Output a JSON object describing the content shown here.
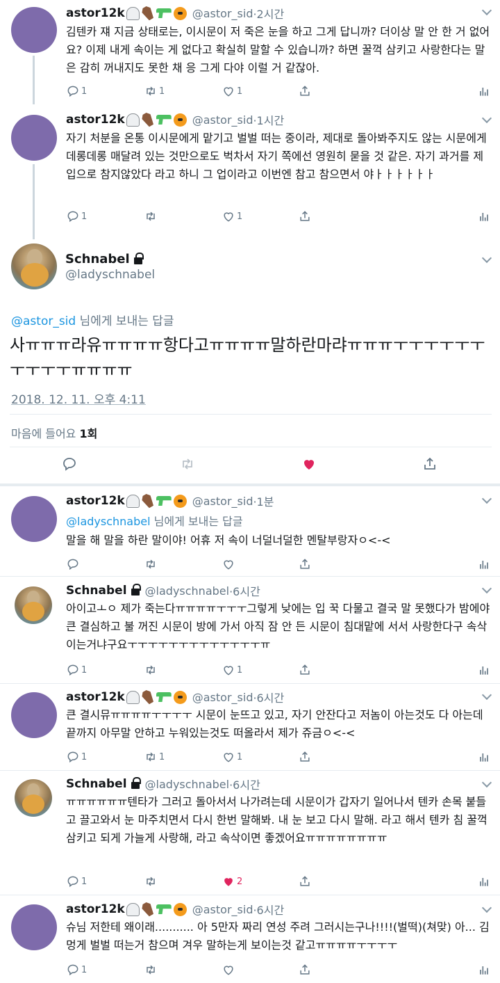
{
  "tweets_before": [
    {
      "name": "astor12k",
      "handle": "@astor_sid",
      "time": "·2시간",
      "text": "김텐카 쟤 지금 상태로는, 이시문이 저 죽은 눈을 하고 그게 답니까? 더이상 말 안 한 거 없어요? 이제 내게 속이는 게 없다고 확실히 말할 수 있습니까? 하면 꿀꺽 삼키고 사랑한다는 말은 감히 꺼내지도 못한 채 응 그게 다야 이럴 거 같잖아.",
      "replies": "1",
      "retweets": "1",
      "likes": "1"
    },
    {
      "name": "astor12k",
      "handle": "@astor_sid",
      "time": "·1시간",
      "text": "자기 처분을 온통 이시문에게 맡기고 벌벌 떠는 중이라, 제대로 돌아봐주지도 않는 시문에게 데롱데롱 매달려 있는 것만으로도 벅차서 자기 쪽에선 영원히 묻을 것 같은. 자기 과거를 제 입으로 참지않았다 라고 하니 그 업이라고 이번엔 참고 참으면서 야ㅏㅏㅏㅏㅏㅏ",
      "replies": "1",
      "retweets": "",
      "likes": "1"
    }
  ],
  "main_tweet": {
    "name": "Schnabel",
    "handle": "@ladyschnabel",
    "reply_to_handle": "@astor_sid",
    "reply_to_suffix": " 님에게 보내는 답글",
    "text": "사ㅠㅠㅠ라유ㅠㅠㅠㅠ항다고ㅠㅠㅠㅠ말하란마랴ㅠㅠㅠㅜㅜㅜㅜㅜㅜㅜㅜㅜㅜㅠㅠㅠㅠ",
    "timestamp": "2018. 12. 11. 오후 4:11",
    "likes_label": "마음에 들어요",
    "likes_count": "1회",
    "liked": true
  },
  "replies_after": [
    {
      "name": "astor12k",
      "handle": "@astor_sid",
      "time": "·1분",
      "reply_to_handle": "@ladyschnabel",
      "reply_to_suffix": " 님에게 보내는 답글",
      "text": "말을 해 말을 하란 말이야! 어휴 저 속이 너덜너덜한 멘탈부랑자ㅇ<-<",
      "replies": "",
      "retweets": "",
      "likes": ""
    },
    {
      "name": "Schnabel",
      "handle": "@ladyschnabel",
      "time": "·6시간",
      "text": "아이고ㅗㅇ 제가 죽는다ㅠㅠㅠㅠㅜㅜㅜ그렇게 낮에는 입 꾹 다물고 결국 말 못했다가 밤에야 큰 결심하고 불 꺼진 시문이 방에 가서 아직 잠 안 든 시문이 침대맡에 서서 사랑한다구 속삭이는거냐구요ㅜㅜㅜㅜㅜㅜㅜㅜㅜㅜㅜㅜㅜㅠ",
      "replies": "1",
      "retweets": "",
      "likes": "1"
    },
    {
      "name": "astor12k",
      "handle": "@astor_sid",
      "time": "·6시간",
      "text": "큰 결시뮤ㅠㅠㅠㅠㅜㅜㅜㅜ 시문이 눈뜨고 있고, 자기 안잔다고 저놈이 아는것도 다 아는데 끝까지 아무말 안하고 누워있는것도 떠올라서 제가 쥬금ㅇ<-<",
      "replies": "1",
      "retweets": "1",
      "likes": "1"
    },
    {
      "name": "Schnabel",
      "handle": "@ladyschnabel",
      "time": "·6시간",
      "text": "ㅠㅠㅠㅠㅠㅠ텐타가 그러고 돌아서서 나가려는데 시문이가 갑자기 일어나서 텐카 손목 붙들고 끌고와서 눈 마주치면서 다시 한번 말해봐. 내 눈 보고 다시 말해. 라고 해서 텐카 침 꿀꺽 삼키고 되게 가늘게 사랑해, 라고 속삭이면 좋겠어요ㅠㅠㅠㅠㅠㅠㅠㅠ",
      "replies": "1",
      "retweets": "",
      "likes": "2",
      "liked": true
    },
    {
      "name": "astor12k",
      "handle": "@astor_sid",
      "time": "·6시간",
      "text": "슈님 저한테 왜이래........... 아 5만자 짜리 연성 주려 그러시는구나!!!!(벌떡)(쳐맞) 아... 김멍게 벌벌 떠는거 참으며 겨우 말하는게 보이는것 같고ㅠㅠㅠㅠㅜㅜㅜㅜ",
      "replies": "1",
      "retweets": "",
      "likes": ""
    }
  ],
  "icons": {
    "reply": "reply-icon",
    "retweet": "retweet-icon",
    "like": "heart-icon",
    "share": "share-icon",
    "analytics": "analytics-icon",
    "more": "chevron-down-icon"
  },
  "colors": {
    "accent_link": "#1b95e0",
    "like_red": "#e0245e",
    "muted": "#657786",
    "avatar_purple": "#7e6bab"
  }
}
